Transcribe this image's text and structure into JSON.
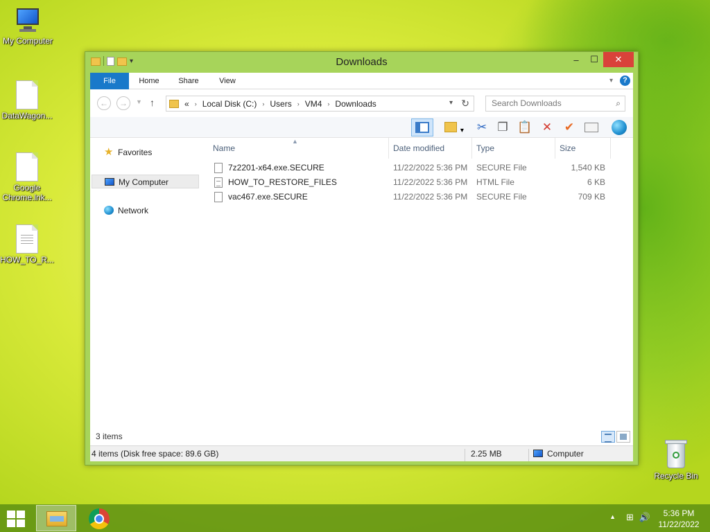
{
  "desktop": {
    "icons": [
      {
        "label": "My Computer"
      },
      {
        "label": "DataWagon..."
      },
      {
        "label": "Google Chrome.lnk..."
      },
      {
        "label": "HOW_TO_R..."
      },
      {
        "label": "Recycle Bin"
      }
    ]
  },
  "window": {
    "title": "Downloads",
    "controls": {
      "minimize": "–",
      "maximize": "☐",
      "close": "✕"
    }
  },
  "ribbon": {
    "tabs": [
      "File",
      "Home",
      "Share",
      "View"
    ],
    "help": "?"
  },
  "nav": {
    "back": "←",
    "forward": "→",
    "up": "↑",
    "breadcrumb_prefix": "«",
    "breadcrumb": [
      "Local Disk (C:)",
      "Users",
      "VM4",
      "Downloads"
    ],
    "search_placeholder": "Search Downloads"
  },
  "toolbar": {
    "cut": "✂",
    "copy": "❐",
    "paste": "📋",
    "delete": "✕",
    "rename": "✔"
  },
  "sidebar": {
    "items": [
      {
        "label": "Favorites",
        "icon": "star-icon"
      },
      {
        "label": "My Computer",
        "icon": "computer-icon",
        "selected": true
      },
      {
        "label": "Network",
        "icon": "network-icon"
      }
    ]
  },
  "filelist": {
    "columns": [
      "Name",
      "Date modified",
      "Type",
      "Size"
    ],
    "rows": [
      {
        "name": "7z2201-x64.exe.SECURE",
        "date": "11/22/2022 5:36 PM",
        "type": "SECURE File",
        "size": "1,540 KB"
      },
      {
        "name": "HOW_TO_RESTORE_FILES",
        "date": "11/22/2022 5:36 PM",
        "type": "HTML File",
        "size": "6 KB"
      },
      {
        "name": "vac467.exe.SECURE",
        "date": "11/22/2022 5:36 PM",
        "type": "SECURE File",
        "size": "709 KB"
      }
    ]
  },
  "countbar": {
    "text": "3 items"
  },
  "statusbar": {
    "left": "4 items (Disk free space: 89.6 GB)",
    "size": "2.25 MB",
    "location": "Computer"
  },
  "taskbar": {
    "clock_time": "5:36 PM",
    "clock_date": "11/22/2022"
  },
  "colors": {
    "window_frame": "#a7d45a",
    "accent": "#1979ca",
    "close": "#d9423a"
  }
}
